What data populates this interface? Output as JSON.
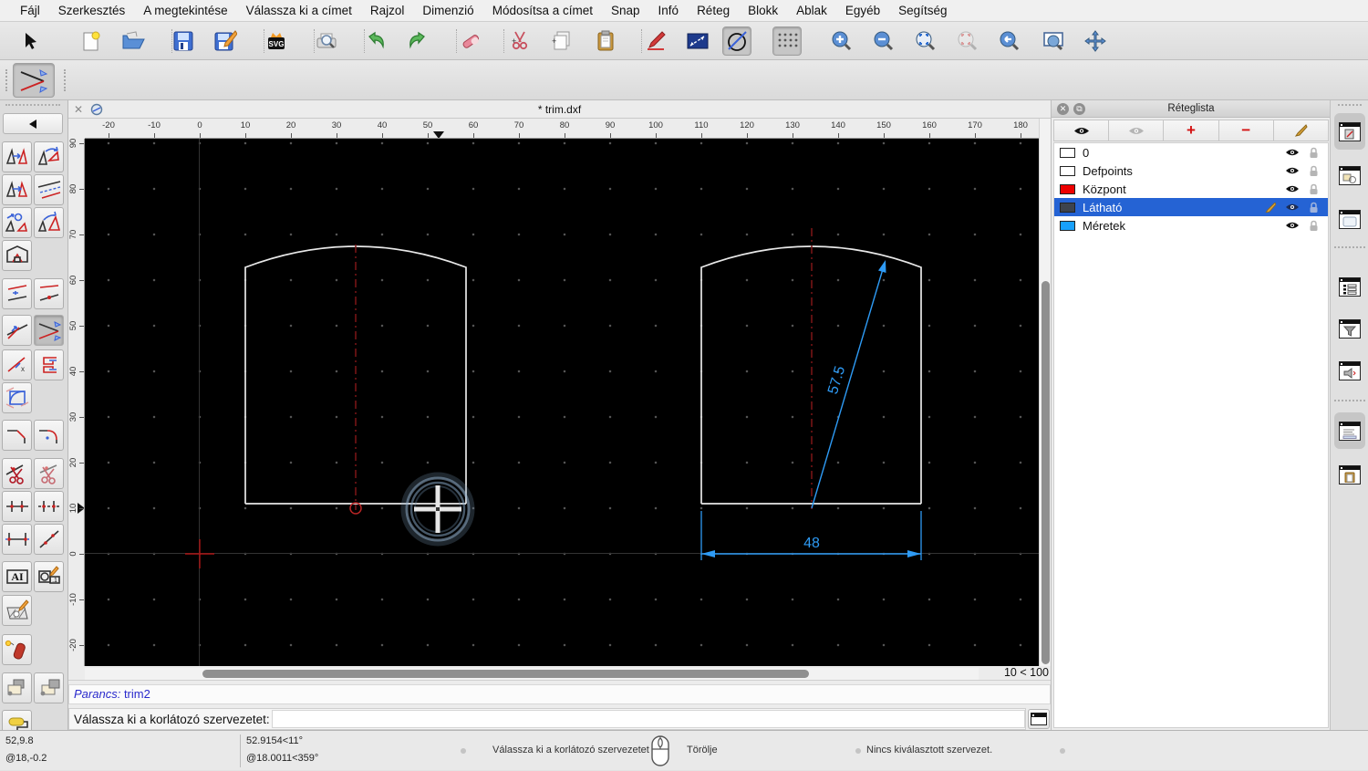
{
  "menu": {
    "items": [
      "Fájl",
      "Szerkesztés",
      "A megtekintése",
      "Válassza ki a címet",
      "Rajzol",
      "Dimenzió",
      "Módosítsa a címet",
      "Snap",
      "Infó",
      "Réteg",
      "Blokk",
      "Ablak",
      "Egyéb",
      "Segítség"
    ]
  },
  "toolbars": {
    "main_icons": [
      "select-arrow-icon",
      "new-file-icon",
      "open-folder-icon",
      "save-icon",
      "save-as-icon",
      "svg-export-icon",
      "print-preview-icon",
      "undo-icon",
      "redo-icon",
      "eraser-icon",
      "cut-icon",
      "copy-icon",
      "paste-icon",
      "draw-pencil-icon",
      "dimension-icon",
      "trim-circle-icon",
      "grid-toggle-icon",
      "zoom-in-icon",
      "zoom-out-icon",
      "zoom-auto-icon",
      "zoom-selection-icon",
      "zoom-previous-icon",
      "zoom-window-icon",
      "pan-icon"
    ],
    "options_icon": "trim-two-icon"
  },
  "document": {
    "title": "* trim.dxf"
  },
  "rulers": {
    "h_ticks": [
      -20,
      -10,
      0,
      10,
      20,
      30,
      40,
      50,
      60,
      70,
      80,
      90,
      100,
      110,
      120,
      130,
      140,
      150,
      160,
      170,
      180
    ],
    "v_ticks": [
      90,
      80,
      70,
      60,
      50,
      40,
      30,
      20,
      10,
      0,
      -10,
      -20
    ]
  },
  "drawing": {
    "dim_diagonal": "57.5",
    "dim_width": "48",
    "grid_status": "10 < 100",
    "colors": {
      "outline": "#e8e8e8",
      "centerline": "#7d1517",
      "dimension": "#2e9bf5"
    }
  },
  "command": {
    "history_label": "Parancs:",
    "history_command": "trim2",
    "prompt_label": "Válassza ki a korlátozó szervezetet:",
    "input_value": ""
  },
  "layers_panel": {
    "title": "Réteglista",
    "layers": [
      {
        "name": "0",
        "color": "#ffffff",
        "selected": false
      },
      {
        "name": "Defpoints",
        "color": "#ffffff",
        "selected": false
      },
      {
        "name": "Központ",
        "color": "#ee0000",
        "selected": false
      },
      {
        "name": "Látható",
        "color": "#3d434d",
        "selected": true
      },
      {
        "name": "Méretek",
        "color": "#18a0fb",
        "selected": false
      }
    ]
  },
  "right_strip_icons": [
    "layer-list-window-icon",
    "block-list-window-icon",
    "library-browser-window-icon",
    "property-list-window-icon",
    "selection-filter-window-icon",
    "command-history-window-icon",
    "command-line-window-icon",
    "clipboard-window-icon"
  ],
  "status_bar": {
    "abs_coord": "52,9.8",
    "rel_coord": "@18,-0.2",
    "abs_polar": "52.9154<11°",
    "rel_polar": "@18.0011<359°",
    "left_mouse_action": "Válassza ki a korlátozó szervezetet",
    "right_mouse_action": "Törölje",
    "selection_status": "Nincs kiválasztott szervezet."
  }
}
